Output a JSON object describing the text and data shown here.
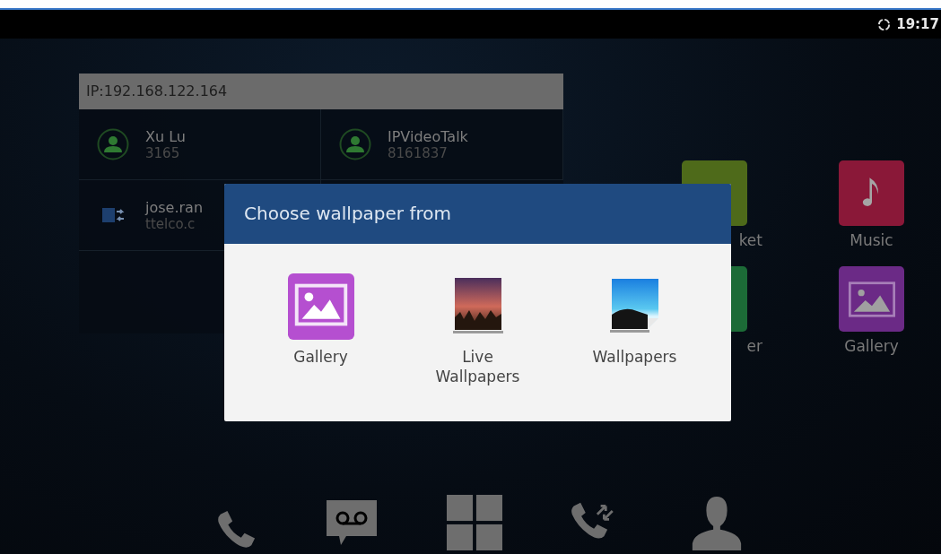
{
  "status_bar": {
    "time": "19:17"
  },
  "widget": {
    "ip": "IP:192.168.122.164",
    "contacts": [
      {
        "kind": "person",
        "name": "Xu Lu",
        "number": "3165"
      },
      {
        "kind": "person",
        "name": "IPVideoTalk",
        "number": "8161837"
      },
      {
        "kind": "lync",
        "name": "jose.ran",
        "number": "ttelco.c"
      }
    ]
  },
  "apps": [
    {
      "kind": "market",
      "label": "ket",
      "color": "#4e6a1a"
    },
    {
      "kind": "music",
      "label": "Music",
      "color": "#8a1838"
    },
    {
      "kind": "other",
      "label": "er",
      "color": "#1c6b37"
    },
    {
      "kind": "gallery",
      "label": "Gallery",
      "color": "#6b2a86"
    }
  ],
  "dialog": {
    "title": "Choose wallpaper from",
    "options": [
      {
        "kind": "gallery",
        "label": "Gallery"
      },
      {
        "kind": "live",
        "label": "Live Wallpapers"
      },
      {
        "kind": "wallpapers",
        "label": "Wallpapers"
      }
    ]
  },
  "dock": [
    {
      "kind": "phone"
    },
    {
      "kind": "voicemail"
    },
    {
      "kind": "apps"
    },
    {
      "kind": "transfer"
    },
    {
      "kind": "contact"
    }
  ]
}
